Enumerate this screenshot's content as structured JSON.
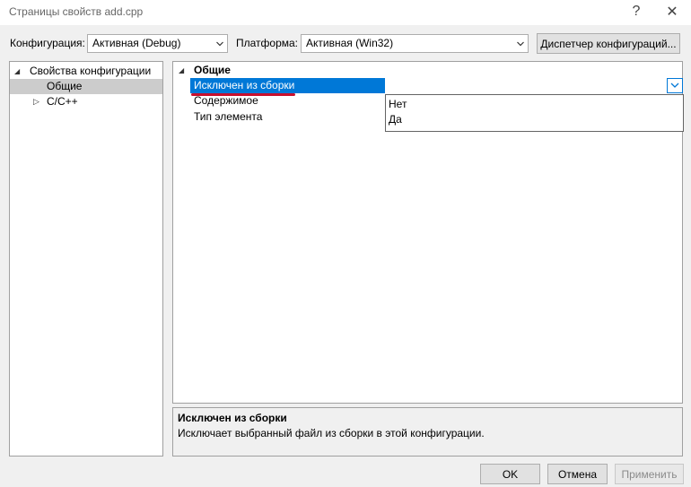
{
  "window": {
    "title": "Страницы свойств add.cpp",
    "help_glyph": "?",
    "close_glyph": "✕"
  },
  "config_bar": {
    "configuration_label": "Конфигурация:",
    "configuration_value": "Активная (Debug)",
    "platform_label": "Платформа:",
    "platform_value": "Активная (Win32)",
    "config_manager_label": "Диспетчер конфигураций..."
  },
  "tree": {
    "root": {
      "label": "Свойства конфигурации",
      "expander": "◢"
    },
    "items": [
      {
        "label": "Общие",
        "selected": true
      },
      {
        "label": "C/C++",
        "expander": "▷"
      }
    ]
  },
  "grid": {
    "category": {
      "label": "Общие",
      "expander": "◢"
    },
    "properties": [
      {
        "name": "Исключен из сборки",
        "value": "",
        "selected": true
      },
      {
        "name": "Содержимое",
        "value": ""
      },
      {
        "name": "Тип элемента",
        "value": ""
      }
    ],
    "dropdown_options": [
      "Нет",
      "Да"
    ]
  },
  "description": {
    "title": "Исключен из сборки",
    "text": "Исключает выбранный файл из сборки в этой конфигурации."
  },
  "buttons": {
    "ok": "OK",
    "cancel": "Отмена",
    "apply": "Применить"
  },
  "colors": {
    "selection": "#0078d7",
    "tree_selection": "#cccccc",
    "annotation_underline": "#c8102e"
  }
}
